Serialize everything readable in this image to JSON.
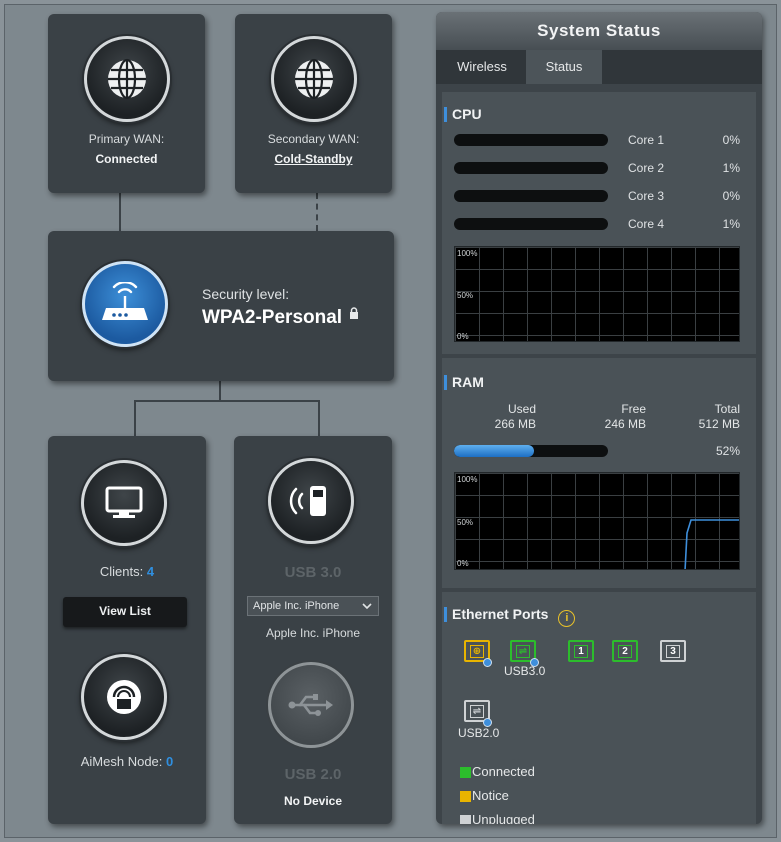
{
  "wan": {
    "primary": {
      "label": "Primary WAN:",
      "status": "Connected"
    },
    "secondary": {
      "label": "Secondary WAN:",
      "status": "Cold-Standby"
    }
  },
  "router": {
    "security_label": "Security level:",
    "security_value": "WPA2-Personal"
  },
  "clients": {
    "label": "Clients:",
    "count": "4",
    "button": "View List"
  },
  "aimesh": {
    "label": "AiMesh Node:",
    "count": "0"
  },
  "usb30": {
    "label": "USB 3.0",
    "selected_device": "Apple Inc. iPhone",
    "device_name": "Apple Inc. iPhone"
  },
  "usb20": {
    "label": "USB 2.0",
    "status": "No Device"
  },
  "system_status": {
    "title": "System Status",
    "tabs": [
      "Wireless",
      "Status"
    ],
    "active_tab": "Status",
    "cpu": {
      "heading": "CPU",
      "cores": [
        {
          "name": "Core 1",
          "percent": "0%",
          "value": 0
        },
        {
          "name": "Core 2",
          "percent": "1%",
          "value": 1
        },
        {
          "name": "Core 3",
          "percent": "0%",
          "value": 0
        },
        {
          "name": "Core 4",
          "percent": "1%",
          "value": 1
        }
      ],
      "graph_ticks": [
        "100%",
        "50%",
        "0%"
      ]
    },
    "ram": {
      "heading": "RAM",
      "used_label": "Used",
      "used_value": "266 MB",
      "free_label": "Free",
      "free_value": "246 MB",
      "total_label": "Total",
      "total_value": "512 MB",
      "percent": "52%",
      "usage_fraction": 0.52,
      "graph_ticks": [
        "100%",
        "50%",
        "0%"
      ]
    },
    "ethernet": {
      "heading": "Ethernet Ports",
      "ports": [
        {
          "id": "wan",
          "label": "",
          "state": "Notice",
          "color": "#e8b400"
        },
        {
          "id": "usb3-port",
          "label": "",
          "state": "Connected",
          "color": "#2cbd2c"
        },
        {
          "id": "lan1",
          "label": "1",
          "state": "Connected",
          "color": "#2cbd2c"
        },
        {
          "id": "lan2",
          "label": "2",
          "state": "Connected",
          "color": "#2cbd2c"
        },
        {
          "id": "lan3",
          "label": "3",
          "state": "Unplugged",
          "color": "#cfd2d4"
        }
      ],
      "usb3_label": "USB3.0",
      "usb2_label": "USB2.0",
      "legend": [
        {
          "label": "Connected",
          "color": "#2cbd2c"
        },
        {
          "label": "Notice",
          "color": "#e8b400"
        },
        {
          "label": "Unplugged",
          "color": "#cfd2d4"
        }
      ]
    }
  },
  "colors": {
    "accent_blue": "#2f8fe0",
    "card_bg": "#3a4146",
    "page_bg": "#8a9399"
  }
}
